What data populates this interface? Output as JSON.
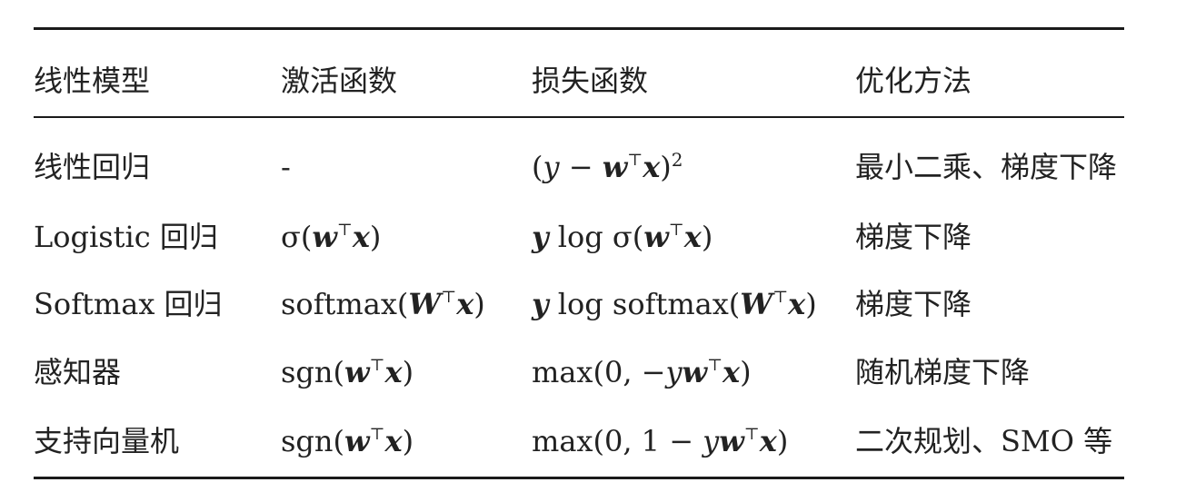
{
  "table": {
    "headers": [
      "线性模型",
      "激活函数",
      "损失函数",
      "优化方法"
    ],
    "rows": [
      {
        "model": "线性回归",
        "activation": "-",
        "loss": "(y − w⊤x)²",
        "optimization": "最小二乘、梯度下降"
      },
      {
        "model": "Logistic 回归",
        "activation": "σ(w⊤x)",
        "loss": "y log σ(w⊤x)",
        "optimization": "梯度下降"
      },
      {
        "model": "Softmax 回归",
        "activation": "softmax(W⊤x)",
        "loss": "y log softmax(W⊤x)",
        "optimization": "梯度下降"
      },
      {
        "model": "感知器",
        "activation": "sgn(w⊤x)",
        "loss": "max(0, −yw⊤x)",
        "optimization": "随机梯度下降"
      },
      {
        "model": "支持向量机",
        "activation": "sgn(w⊤x)",
        "loss": "max(0, 1 − yw⊤x)",
        "optimization": "二次规划、SMO 等"
      }
    ]
  }
}
